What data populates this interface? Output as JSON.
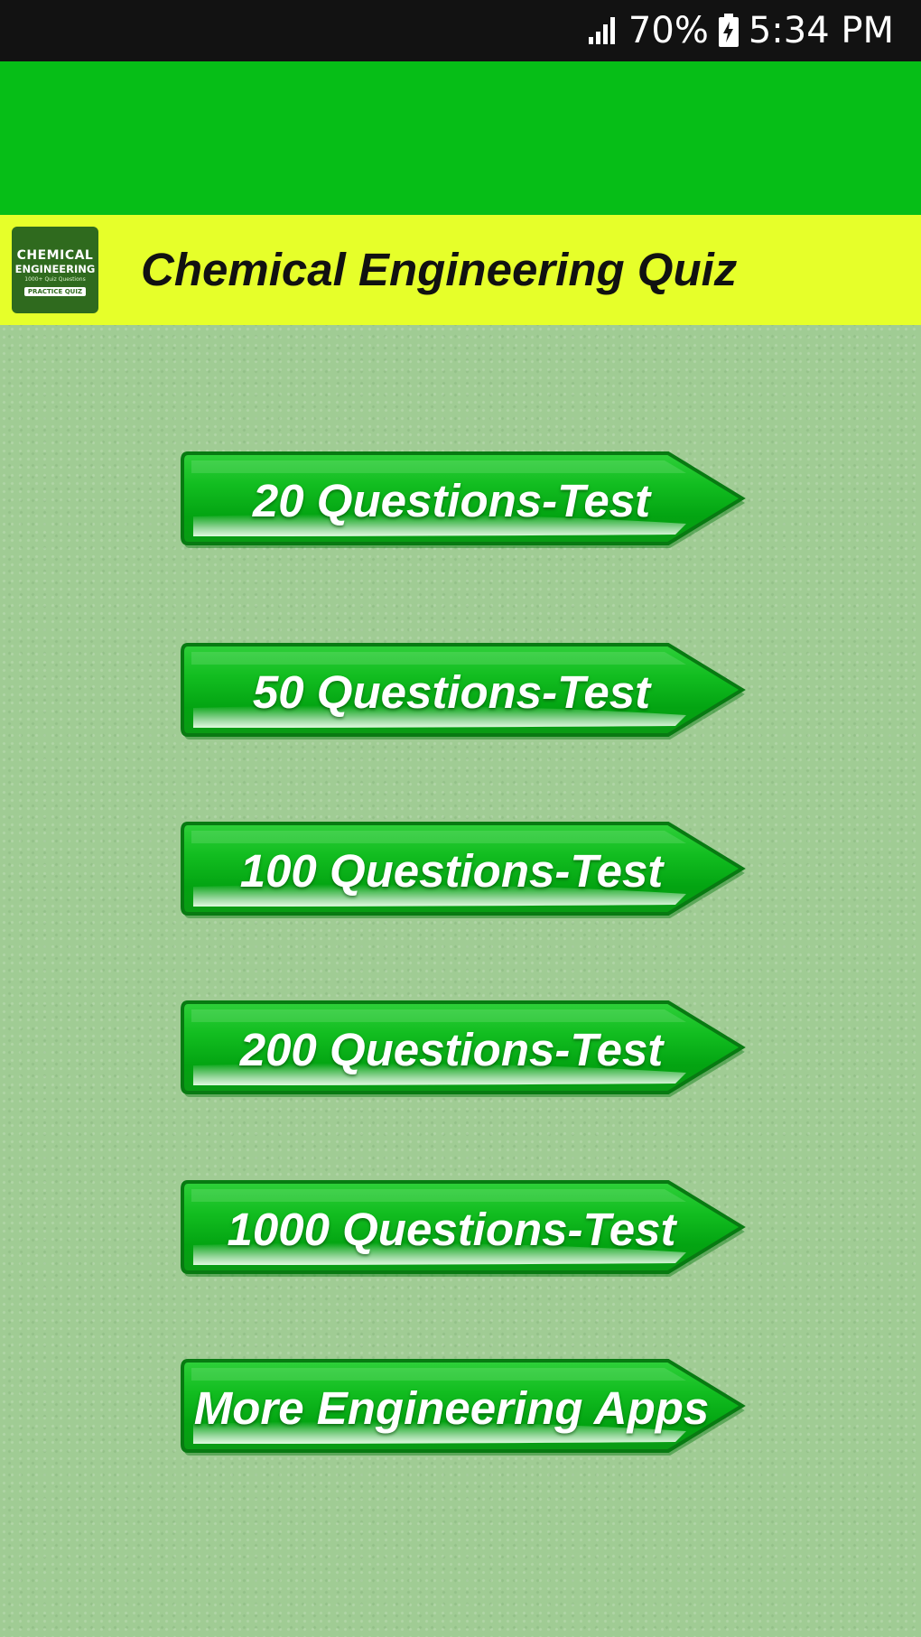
{
  "status_bar": {
    "battery": "70%",
    "time": "5:34 PM"
  },
  "header": {
    "logo": {
      "line1": "CHEMICAL",
      "line2": "ENGINEERING",
      "line3": "1000+ Quiz Questions",
      "line4": "PRACTICE QUIZ"
    },
    "title": "Chemical Engineering Quiz"
  },
  "menu": {
    "buttons": [
      {
        "label": "20 Questions-Test"
      },
      {
        "label": "50 Questions-Test"
      },
      {
        "label": "100 Questions-Test"
      },
      {
        "label": "200 Questions-Test"
      },
      {
        "label": "1000 Questions-Test"
      },
      {
        "label": "More Engineering Apps"
      }
    ]
  },
  "colors": {
    "banner": "#06be17",
    "title_bar": "#e6ff2a",
    "background": "#a0cc94",
    "button": "#0ab01a"
  }
}
